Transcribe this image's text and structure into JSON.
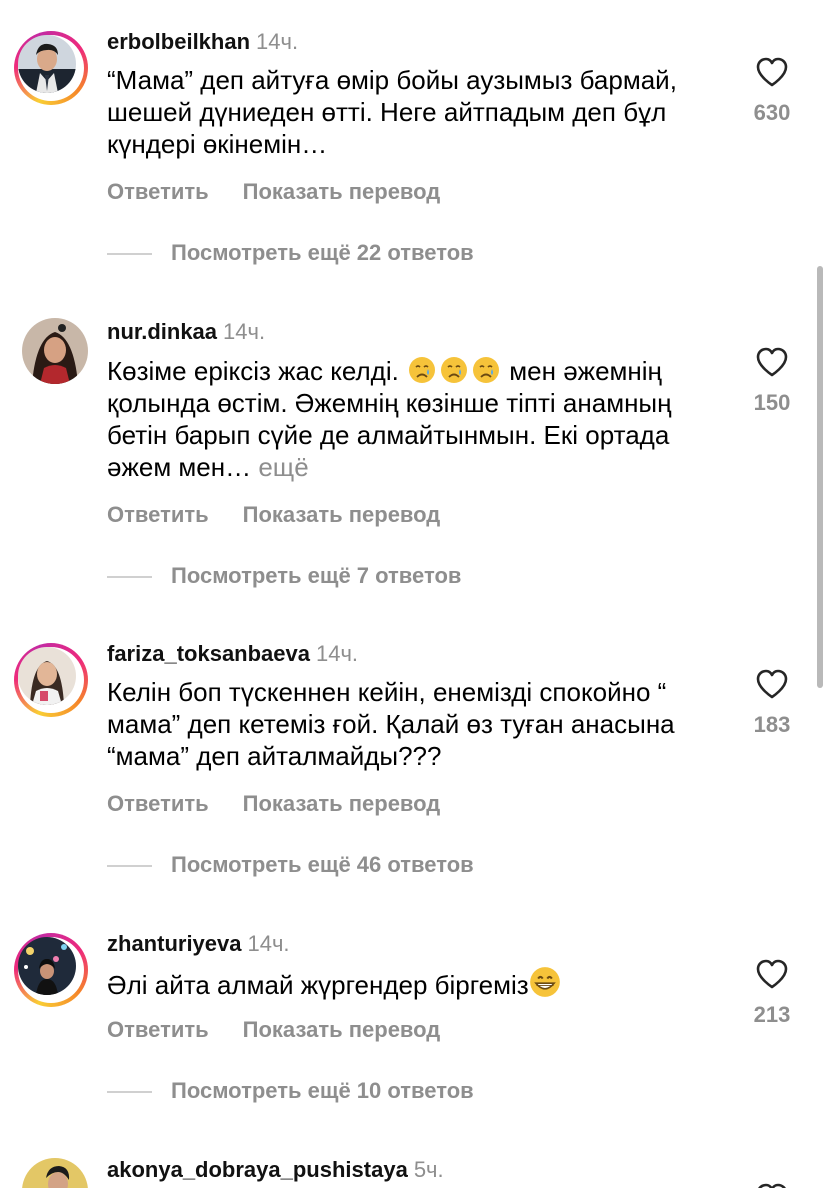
{
  "ui": {
    "reply_label": "Ответить",
    "translate_label": "Показать перевод",
    "more_label": "ещё",
    "heart_icon": "heart-outline-icon",
    "emoji_icons": [
      "crying-face-icon",
      "grinning-face-icon"
    ]
  },
  "comments": [
    {
      "username": "erbolbeilkhan",
      "time": "14ч.",
      "text": "“Мама” деп айтуға өмір бойы аузымыз бармай, шешей дүниеден өтті. Неге айтпадым деп бұл күндері өкінемін…",
      "likes": "630",
      "view_replies": "Посмотреть ещё 22 ответов"
    },
    {
      "username": "nur.dinkaa",
      "time": "14ч.",
      "text_a": "Көзіме еріксіз жас келді.",
      "text_b": " мен әжемнің қолында өстім. Әжемнің көзінше тіпті  анамның бетін барып сүйе де алмайтынмын. Екі ортада әжем мен…",
      "likes": "150",
      "view_replies": "Посмотреть ещё 7 ответов"
    },
    {
      "username": "fariza_toksanbaeva",
      "time": "14ч.",
      "text": "Келін боп түскеннен кейін, енемізді спокойно “ мама” деп кетеміз ғой. Қалай өз туған анасына “мама” деп айталмайды???",
      "likes": "183",
      "view_replies": "Посмотреть ещё 46 ответов"
    },
    {
      "username": "zhanturiyeva",
      "time": "14ч.",
      "text": "Әлі айта алмай жүргендер біргеміз",
      "likes": "213",
      "view_replies": "Посмотреть ещё 10 ответов"
    },
    {
      "username": "akonya_dobraya_pushistaya",
      "time": "5ч."
    }
  ]
}
